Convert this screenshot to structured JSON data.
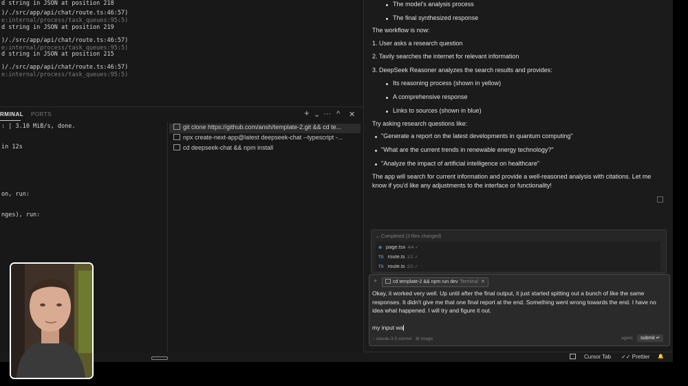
{
  "log": {
    "lines": [
      {
        "text": "d string in JSON at position 218",
        "dim": false
      },
      {
        "text": ")/./src/app/api/chat/route.ts:46:57)",
        "dim": false
      },
      {
        "text": "e:internal/process/task_queues:95:5)",
        "dim": true
      },
      {
        "text": "d string in JSON at position 219",
        "dim": false
      },
      {
        "text": ")/./src/app/api/chat/route.ts:46:57)",
        "dim": false
      },
      {
        "text": "e:internal/process/task_queues:95:5)",
        "dim": true
      },
      {
        "text": "d string in JSON at position 215",
        "dim": false
      },
      {
        "text": ")/./src/app/api/chat/route.ts:46:57)",
        "dim": false
      },
      {
        "text": "e:internal/process/task_queues:95:5)",
        "dim": true
      }
    ]
  },
  "terminal": {
    "tabs": [
      "RMINAL",
      "PORTS"
    ],
    "actions": {
      "add": "+",
      "dropdown": "⌄",
      "more": "···",
      "maximize": "^",
      "close": "✕"
    },
    "lines": [
      ": | 3.10 MiB/s, done.",
      "in 12s",
      "on, run:",
      "nges), run:"
    ],
    "list": [
      "git clone https://github.com/ansh/template-2.git && cd te...",
      "npx create-next-app@latest deepseek-chat --typescript -...",
      "cd deepseek-chat && npm install"
    ]
  },
  "chat": {
    "top_bullets": [
      "The model's analysis process",
      "The final synthesized response"
    ],
    "workflow_heading": "The workflow is now:",
    "steps": [
      "1. User asks a research question",
      "2. Tavily searches the internet for relevant information",
      "3. DeepSeek Reasoner analyzes the search results and provides:"
    ],
    "step_bullets": [
      "Its reasoning process (shown in yellow)",
      "A comprehensive response",
      "Links to sources (shown in blue)"
    ],
    "try_heading": "Try asking research questions like:",
    "examples": [
      "\"Generate a report on the latest developments in quantum computing\"",
      "\"What are the current trends in renewable energy technology?\"",
      "\"Analyze the impact of artificial intelligence on healthcare\""
    ],
    "closing": "The app will search for current information and provide a well-reasoned analysis with citations. Let me know if you'd like any adjustments to the interface or functionality!"
  },
  "completed": {
    "header": "⌄ Completed (3 files changed)",
    "files": [
      {
        "badge": "⊕",
        "name": "page.tsx",
        "count": "4/4 ✓"
      },
      {
        "badge": "TS",
        "name": "route.ts",
        "count": "1/1 ✓"
      },
      {
        "badge": "TS",
        "name": "route.ts",
        "count": "2/2 ✓"
      }
    ]
  },
  "composer": {
    "plus": "+",
    "chip_label": "cd template-2 && npm run dev",
    "chip_kind": "Terminal",
    "chip_close": "✕",
    "message": "Okay, it worked very well. Up until after the final output, it just started spitting out a bunch of like the same responses. It didn't give me that one final report at the end. Something went wrong towards the end. I have no idea what happened. I will try and figure it out.",
    "typing": "my input wa",
    "model": "~ claude-3.5-sonnet",
    "image_label": "⊞ image",
    "mode": "agent",
    "submit": "submit ↵"
  },
  "statusbar": {
    "cursor_tab": "Cursor Tab",
    "prettier": "✓✓ Prettier",
    "bell": "🔔"
  }
}
